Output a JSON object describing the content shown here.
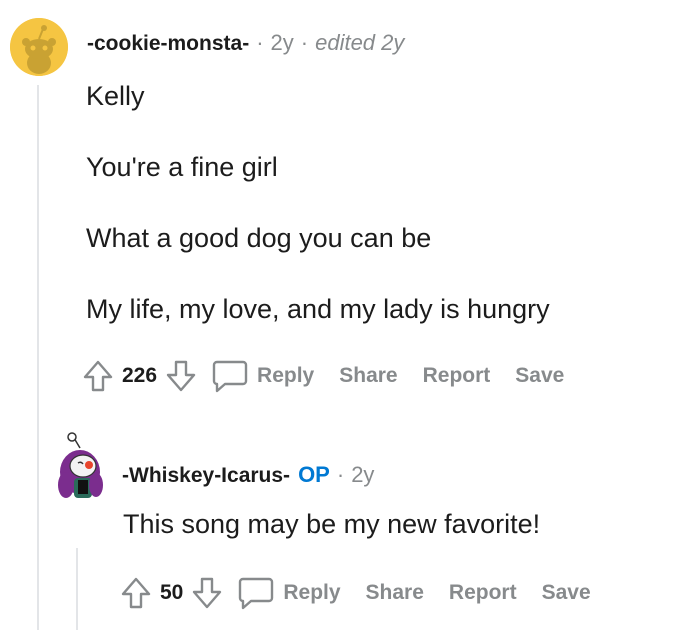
{
  "comment": {
    "username": "-cookie-monsta-",
    "age": "2y",
    "edited": "edited 2y",
    "lines": [
      "Kelly",
      "You're a fine girl",
      "What a good dog you can be",
      "My life, my love, and my lady is hungry"
    ],
    "score": "226",
    "actions": {
      "reply": "Reply",
      "share": "Share",
      "report": "Report",
      "save": "Save"
    },
    "colors": {
      "avatar_bg": "#f5c542"
    }
  },
  "reply": {
    "username": "-Whiskey-Icarus-",
    "op_badge": "OP",
    "age": "2y",
    "text": "This song may be my new favorite!",
    "score": "50",
    "actions": {
      "reply": "Reply",
      "share": "Share",
      "report": "Report",
      "save": "Save"
    },
    "colors": {
      "hair": "#7b2d8e",
      "op": "#0079d3"
    }
  },
  "icons": {
    "upvote": "upvote-icon",
    "downvote": "downvote-icon",
    "reply": "speech-bubble-icon"
  }
}
